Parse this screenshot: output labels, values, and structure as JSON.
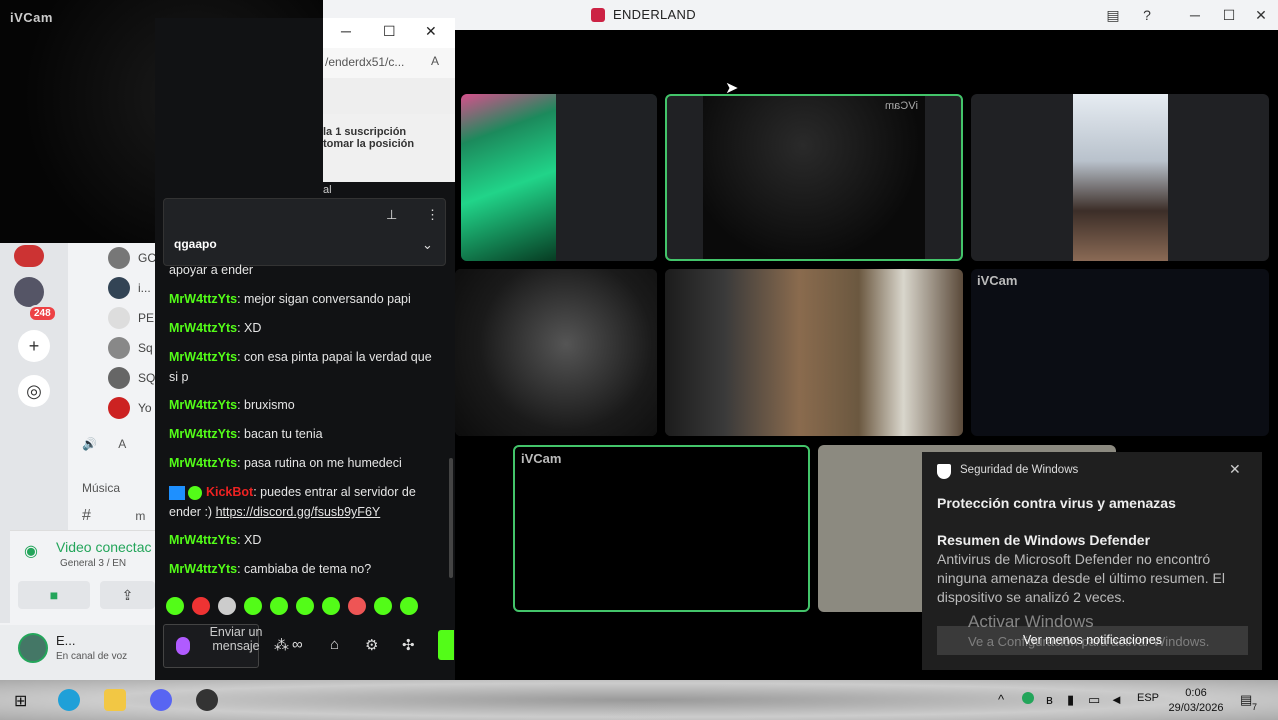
{
  "discord": {
    "window_title": "ENDERLAND",
    "badge_count": "248",
    "members": [
      {
        "label": "GC"
      },
      {
        "label": "i..."
      },
      {
        "label": "PE"
      },
      {
        "label": "Sq"
      },
      {
        "label": "SQ"
      },
      {
        "label": "Yo"
      }
    ],
    "voice_row_label": "A",
    "music_label": "Música",
    "channel_row_label": "m",
    "voice_connected": "Video conectac",
    "voice_channel": "General 3 / EN",
    "user_name": "E...",
    "user_status": "En canal de voz"
  },
  "ivcam": {
    "label": "iVCam"
  },
  "browser": {
    "url": "/enderdx51/c...",
    "notice_line1": "la 1 suscripción",
    "notice_line2": "tomar la posición",
    "partial_text": "al",
    "pinned_text": "qgaapo",
    "pinned_text_2": "apoyar a ender"
  },
  "chat": {
    "messages": [
      {
        "user": "MrW4ttzYts",
        "text": ": mejor sigan conversando papi"
      },
      {
        "user": "MrW4ttzYts",
        "text": ": XD"
      },
      {
        "user": "MrW4ttzYts",
        "text": ": con esa pinta papai la verdad que si p"
      },
      {
        "user": "MrW4ttzYts",
        "text": ": bruxismo"
      },
      {
        "user": "MrW4ttzYts",
        "text": ": bacan tu tenia"
      },
      {
        "user": "MrW4ttzYts",
        "text": ": pasa rutina on me humedeci"
      },
      {
        "user": "KickBot",
        "text": ": puedes entrar al servidor de ender :) ",
        "link": "https://discord.gg/fsusb9yF6Y"
      },
      {
        "user": "MrW4ttzYts",
        "text": ": XD"
      },
      {
        "user": "MrW4ttzYts",
        "text": ": cambiaba de tema no?"
      }
    ],
    "input_placeholder": "Enviar un mensaje",
    "infinity": "∞"
  },
  "video": {
    "tile_labels": [
      "iVCam",
      "iVCam",
      "iVCam"
    ],
    "mirrored_label": "iVCam"
  },
  "toast": {
    "header": "Seguridad de Windows",
    "title": "Protección contra virus y amenazas",
    "subtitle": "Resumen de Windows Defender",
    "body": "Antivirus de Microsoft Defender no encontró ninguna amenaza desde el último resumen.  El dispositivo se analizó 2 veces.",
    "button": "Ver menos notificaciones"
  },
  "watermark": {
    "line1": "Activar Windows",
    "line2": "Ve a Configuración para activar Windows."
  },
  "taskbar": {
    "language": "ESP",
    "time": "0:06",
    "date": "29/03/2026",
    "notification_count": "7"
  },
  "colors": {
    "kick_green": "#53fc18",
    "speaking_border": "#43c46a",
    "discord_green": "#23a55a"
  }
}
